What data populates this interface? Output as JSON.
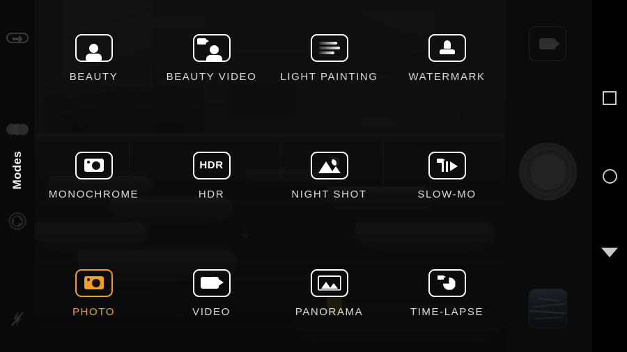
{
  "app": {
    "name": "Camera",
    "orientation": "landscape",
    "accent_color": "#efa021",
    "label_color": "#dcdcdc",
    "panel_background": "#0a0a0a"
  },
  "sidebar": {
    "title": "Modes",
    "buttons": [
      {
        "name": "camera-switch",
        "icon": "camera-switch-icon"
      },
      {
        "name": "filter",
        "icon": "filter-circles-icon"
      },
      {
        "name": "aperture",
        "icon": "aperture-icon"
      },
      {
        "name": "flash-off",
        "icon": "flash-off-icon"
      }
    ]
  },
  "modes": {
    "selected": "PHOTO",
    "items": [
      {
        "label": "BEAUTY",
        "icon": "portrait-icon",
        "selected": false
      },
      {
        "label": "BEAUTY VIDEO",
        "icon": "portrait-video-icon",
        "selected": false
      },
      {
        "label": "LIGHT PAINTING",
        "icon": "light-trails-icon",
        "selected": false
      },
      {
        "label": "WATERMARK",
        "icon": "stamp-icon",
        "selected": false
      },
      {
        "label": "MONOCHROME",
        "icon": "camera-icon",
        "selected": false
      },
      {
        "label": "HDR",
        "icon": "hdr-text-icon",
        "selected": false,
        "icon_text": "HDR"
      },
      {
        "label": "NIGHT SHOT",
        "icon": "mountain-moon-icon",
        "selected": false
      },
      {
        "label": "SLOW-MO",
        "icon": "slow-motion-icon",
        "selected": false
      },
      {
        "label": "PHOTO",
        "icon": "camera-icon",
        "selected": true
      },
      {
        "label": "VIDEO",
        "icon": "video-camera-icon",
        "selected": false
      },
      {
        "label": "PANORAMA",
        "icon": "panorama-icon",
        "selected": false
      },
      {
        "label": "TIME-LAPSE",
        "icon": "time-lapse-icon",
        "selected": false
      }
    ]
  },
  "right_controls": {
    "video_button": {
      "name": "video-record-button",
      "icon": "video-camera-icon",
      "enabled": false
    },
    "shutter_button": {
      "name": "shutter-button",
      "icon": "shutter-circle-icon"
    },
    "gallery_thumbnail": {
      "name": "gallery-thumbnail",
      "icon": "photo-thumbnail"
    }
  },
  "navbar": {
    "buttons": [
      {
        "name": "recents",
        "icon": "square-icon"
      },
      {
        "name": "home",
        "icon": "circle-icon"
      },
      {
        "name": "back",
        "icon": "triangle-down-icon"
      }
    ]
  },
  "viewfinder": {
    "scene": "harbor-with-boats",
    "dimmed": true
  }
}
